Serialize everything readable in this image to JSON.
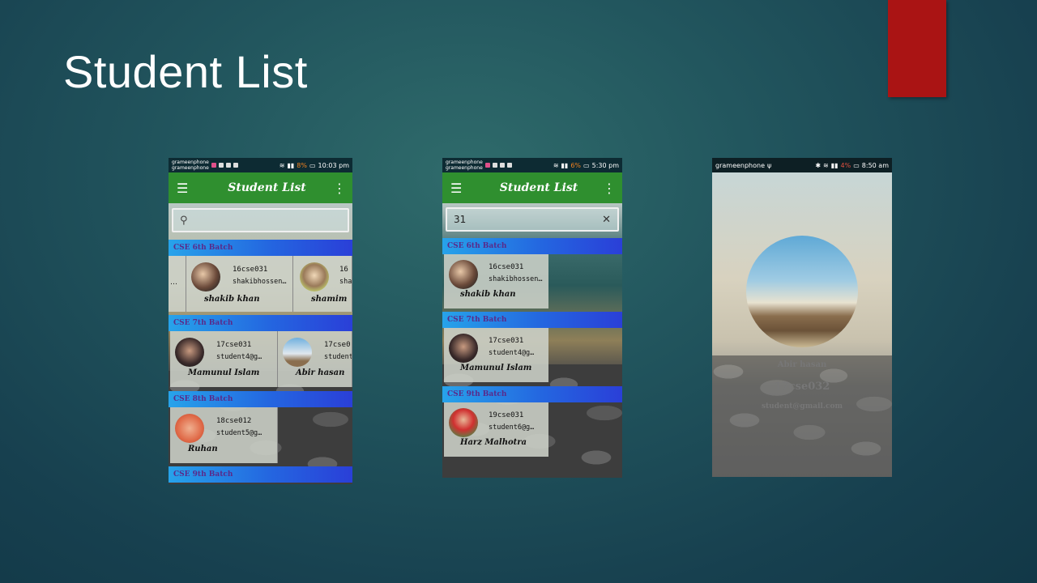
{
  "slide": {
    "title": "Student List",
    "accent_color": "#aa1414"
  },
  "phone1": {
    "status": {
      "carrier1": "grameenphone",
      "carrier2": "grameenphone",
      "battery": "8%",
      "time": "10:03 pm"
    },
    "appbar": {
      "title": "Student List",
      "menu_icon": "hamburger-icon",
      "more_icon": "kebab-icon"
    },
    "search": {
      "value": "",
      "icon": "search-icon"
    },
    "batches": [
      {
        "name": "CSE 6th Batch",
        "cards": [
          {
            "code": "16cse031",
            "email": "shakibhossen…",
            "name": "shakib khan"
          },
          {
            "code": "16",
            "email": "sha",
            "name": "shamim"
          }
        ]
      },
      {
        "name": "CSE 7th Batch",
        "cards": [
          {
            "code": "17cse031",
            "email": "student4@g…",
            "name": "Mamunul Islam"
          },
          {
            "code": "17cse0",
            "email": "student",
            "name": "Abir hasan"
          }
        ]
      },
      {
        "name": "CSE 8th Batch",
        "cards": [
          {
            "code": "18cse012",
            "email": "student5@g…",
            "name": "Ruhan"
          }
        ]
      },
      {
        "name": "CSE 9th Batch",
        "cards": []
      }
    ],
    "partial_left_ellipsis": "…"
  },
  "phone2": {
    "status": {
      "carrier1": "grameenphone",
      "carrier2": "grameenphone",
      "battery": "6%",
      "time": "5:30 pm"
    },
    "appbar": {
      "title": "Student List"
    },
    "search": {
      "value": "31",
      "clear_icon": "close-icon"
    },
    "batches": [
      {
        "name": "CSE 6th Batch",
        "cards": [
          {
            "code": "16cse031",
            "email": "shakibhossen…",
            "name": "shakib khan"
          }
        ]
      },
      {
        "name": "CSE 7th Batch",
        "cards": [
          {
            "code": "17cse031",
            "email": "student4@g…",
            "name": "Mamunul Islam"
          }
        ]
      },
      {
        "name": "CSE 9th Batch",
        "cards": [
          {
            "code": "19cse031",
            "email": "student6@g…",
            "name": "Harz Malhotra"
          }
        ]
      }
    ]
  },
  "phone3": {
    "status": {
      "carrier": "grameenphone",
      "battery": "4%",
      "time": "8:50 am"
    },
    "profile": {
      "name": "Abir hasan",
      "code": "17cse032",
      "email": "student@gmail.com"
    }
  }
}
